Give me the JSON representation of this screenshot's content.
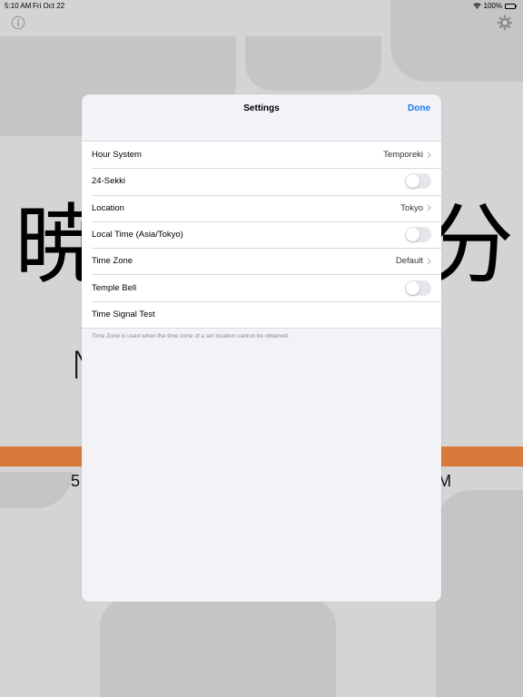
{
  "status_bar": {
    "time": "5:10 AM",
    "date": "Fri Oct 22",
    "battery": "100%"
  },
  "background": {
    "kanji_left": "暁",
    "kanji_right": "分",
    "sub_left": "N",
    "sub_right": ")",
    "time_left": "5",
    "time_right": "M",
    "bar_color": "#d8793b"
  },
  "settings": {
    "title": "Settings",
    "done_label": "Done",
    "rows": [
      {
        "label": "Hour System",
        "value": "Temporeki",
        "type": "disclosure"
      },
      {
        "label": "24-Sekki",
        "type": "toggle",
        "on": false
      },
      {
        "label": "Location",
        "value": "Tokyo",
        "type": "disclosure"
      },
      {
        "label": "Local Time (Asia/Tokyo)",
        "type": "toggle",
        "on": false
      },
      {
        "label": "Time Zone",
        "value": "Default",
        "type": "disclosure"
      },
      {
        "label": "Temple Bell",
        "type": "toggle",
        "on": false
      },
      {
        "label": "Time Signal Test",
        "type": "action"
      }
    ],
    "footer": "Time Zone is used when the time zone of a set location cannot be obtained."
  },
  "colors": {
    "accent": "#1a7aef",
    "modal_bg": "#f2f2f7"
  }
}
